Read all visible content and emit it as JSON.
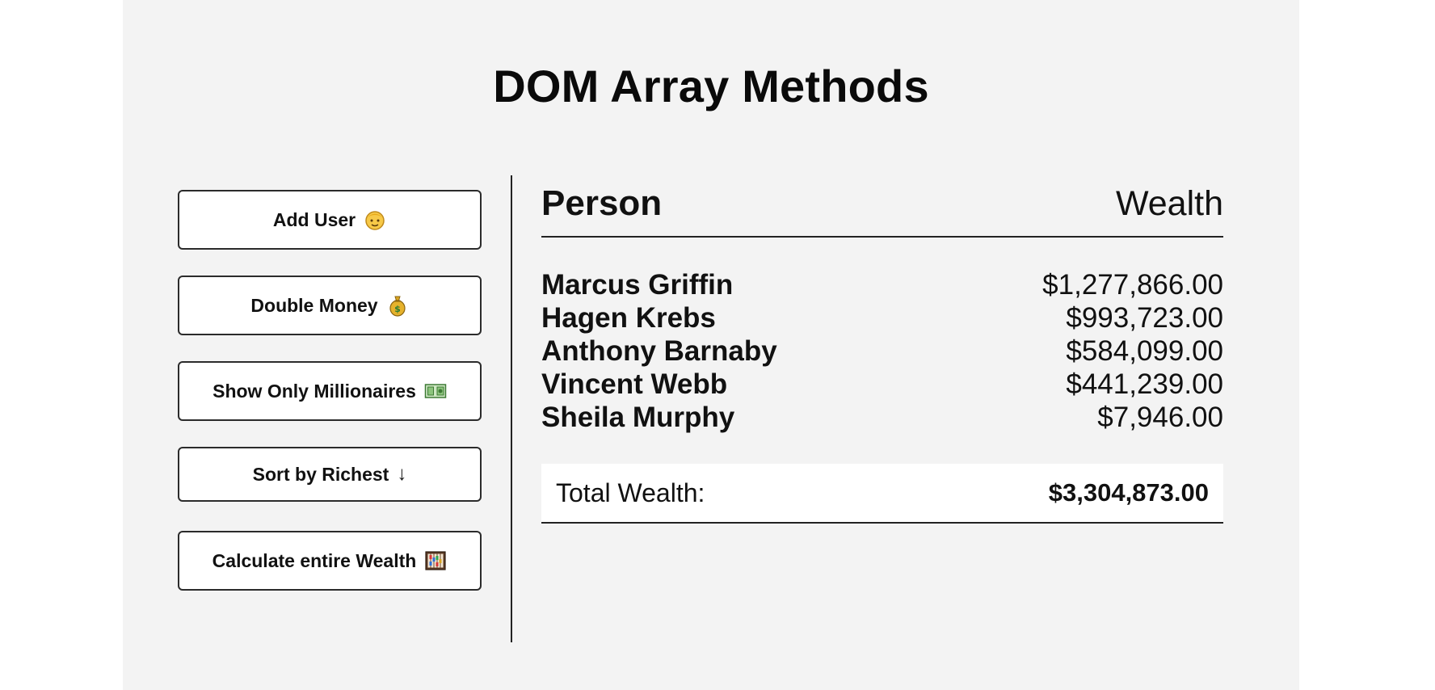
{
  "header": {
    "title": "DOM Array Methods"
  },
  "sidebar": {
    "buttons": [
      {
        "label": "Add User",
        "icon": "person-face-icon"
      },
      {
        "label": "Double Money",
        "icon": "money-bag-icon"
      },
      {
        "label": "Show Only Millionaires",
        "icon": "banknote-icon"
      },
      {
        "label": "Sort by Richest",
        "icon": "down-arrow-icon",
        "glyph": "↓"
      },
      {
        "label": "Calculate entire Wealth",
        "icon": "abacus-icon"
      }
    ]
  },
  "table": {
    "headers": {
      "person": "Person",
      "wealth": "Wealth"
    },
    "rows": [
      {
        "name": "Marcus Griffin",
        "wealth": "$1,277,866.00"
      },
      {
        "name": "Hagen Krebs",
        "wealth": "$993,723.00"
      },
      {
        "name": "Anthony Barnaby",
        "wealth": "$584,099.00"
      },
      {
        "name": "Vincent Webb",
        "wealth": "$441,239.00"
      },
      {
        "name": "Sheila Murphy",
        "wealth": "$7,946.00"
      }
    ],
    "total": {
      "label": "Total Wealth:",
      "value": "$3,304,873.00"
    }
  },
  "colors": {
    "page_background": "#f3f3f3",
    "outer_background": "#ffffff",
    "button_background": "#ffffff",
    "text": "#111111"
  }
}
